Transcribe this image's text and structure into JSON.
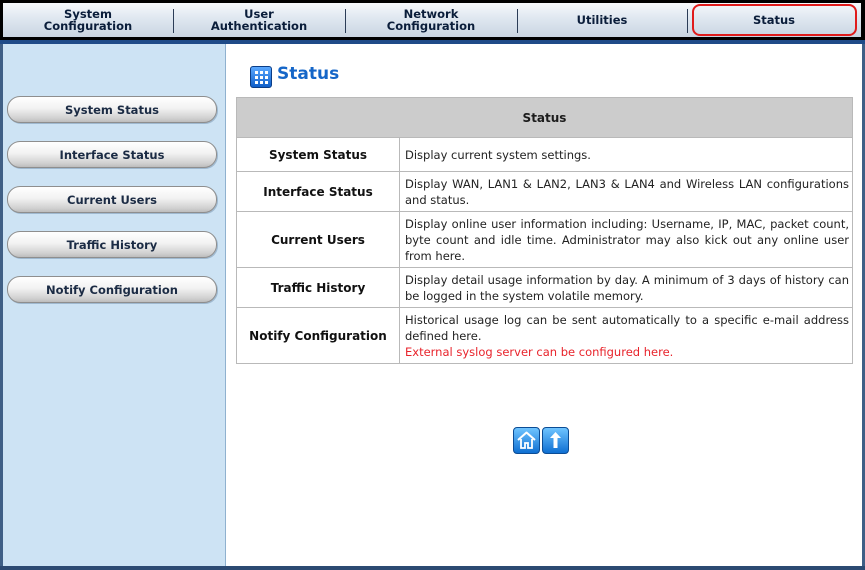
{
  "nav": {
    "tabs": [
      {
        "line1": "System",
        "line2": "Configuration"
      },
      {
        "line1": "User",
        "line2": "Authentication"
      },
      {
        "line1": "Network",
        "line2": "Configuration"
      },
      {
        "line1": "Utilities",
        "line2": ""
      },
      {
        "line1": "Status",
        "line2": ""
      }
    ],
    "active_tab": "Status"
  },
  "sidebar": {
    "items": [
      {
        "label": "System Status"
      },
      {
        "label": "Interface Status"
      },
      {
        "label": "Current Users"
      },
      {
        "label": "Traffic History"
      },
      {
        "label": "Notify Configuration"
      }
    ]
  },
  "page": {
    "title": "Status",
    "title_icon": "grid-icon"
  },
  "table": {
    "header": "Status",
    "rows": [
      {
        "name": "System Status",
        "desc": "Display current system settings.",
        "note": ""
      },
      {
        "name": "Interface Status",
        "desc": "Display WAN, LAN1 & LAN2, LAN3 & LAN4 and Wireless LAN configurations and status.",
        "note": ""
      },
      {
        "name": "Current Users",
        "desc": "Display online user information including: Username, IP, MAC, packet count, byte count and idle time. Administrator may also kick out any online user from here.",
        "note": ""
      },
      {
        "name": "Traffic History",
        "desc": "Display detail usage information by day. A minimum of 3 days of history can be logged in the system volatile memory.",
        "note": ""
      },
      {
        "name": "Notify Configuration",
        "desc": "Historical usage log can be sent automatically to a specific e-mail address defined here.",
        "note": "External syslog server can be configured here."
      }
    ]
  },
  "footer": {
    "icons": [
      "home-icon",
      "up-arrow-icon"
    ]
  },
  "colors": {
    "accent": "#1566c8",
    "highlight": "#e01b1b",
    "sidebar_bg": "#cde3f4",
    "note_text": "#e8232b"
  }
}
